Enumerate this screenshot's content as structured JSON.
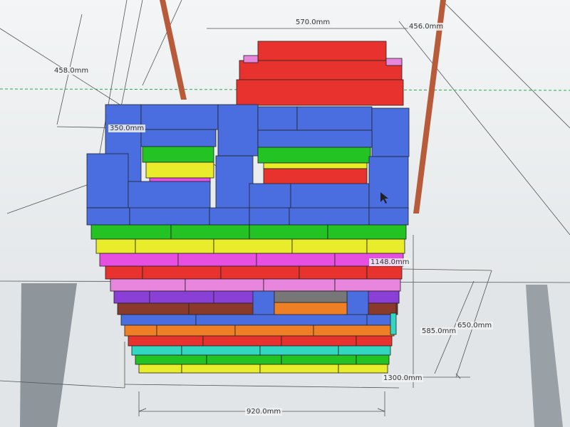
{
  "app": {
    "name": "3D modeling viewport"
  },
  "dimensions": {
    "top_width": "570.0mm",
    "top_right": "456.0mm",
    "left_height": "458.0mm",
    "inner_left": "350.0mm",
    "side_mid": "1148.0mm",
    "height_585": "585.0mm",
    "height_650": "650.0mm",
    "depth_1300": "1300.0mm",
    "bottom_width": "920.0mm"
  },
  "colors": {
    "blue": "#4a6ee0",
    "green": "#22c322",
    "yellow": "#e9ec2a",
    "magenta": "#e64fe0",
    "red": "#e8322e",
    "pink": "#e786dc",
    "purple": "#8a40d6",
    "brown": "#8a3a2a",
    "orange": "#ef7f24",
    "teal": "#33d6c0",
    "pillar": "#b85b3a",
    "guide_green": "#2ea84a",
    "cursor": "#222222"
  }
}
